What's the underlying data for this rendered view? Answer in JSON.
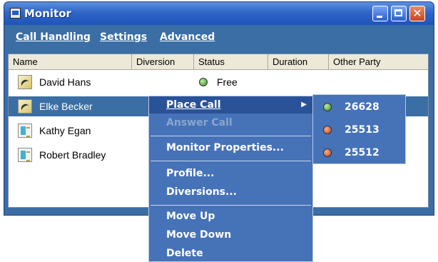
{
  "window": {
    "title": "Monitor",
    "icons": {
      "app": "monitor-app-icon",
      "minimize": "minimize-icon",
      "maximize": "maximize-icon",
      "close": "close-icon"
    }
  },
  "menubar": {
    "items": [
      {
        "label": "Call Handling"
      },
      {
        "label": "Settings"
      },
      {
        "label": "Advanced"
      }
    ]
  },
  "table": {
    "columns": [
      "Name",
      "Diversion",
      "Status",
      "Duration",
      "Other Party"
    ],
    "rows": [
      {
        "name": "David Hans",
        "icon": "phone-icon",
        "status": "Free",
        "status_color": "green",
        "selected": false
      },
      {
        "name": "Elke Becker",
        "icon": "phone-icon",
        "status": "",
        "selected": true
      },
      {
        "name": "Kathy Egan",
        "icon": "contact-card-icon",
        "status": "",
        "selected": false
      },
      {
        "name": "Robert Bradley",
        "icon": "contact-card-icon",
        "status": "",
        "selected": false
      }
    ]
  },
  "context_menu": {
    "items": [
      {
        "label": "Place Call",
        "state": "highlighted",
        "has_submenu": true
      },
      {
        "label": "Answer Call",
        "state": "disabled"
      },
      {
        "label": "Monitor Properties...",
        "state": "normal"
      },
      {
        "label": "Profile...",
        "state": "normal"
      },
      {
        "label": "Diversions...",
        "state": "normal"
      },
      {
        "label": "Move Up",
        "state": "normal"
      },
      {
        "label": "Move Down",
        "state": "normal"
      },
      {
        "label": "Delete",
        "state": "normal"
      }
    ],
    "submenu": [
      {
        "number": "26628",
        "status_color": "green"
      },
      {
        "number": "25513",
        "status_color": "red"
      },
      {
        "number": "25512",
        "status_color": "red"
      }
    ]
  },
  "colors": {
    "selection": "#3a6ea5",
    "menu_background": "#4672b8",
    "menu_highlight": "#2a5298",
    "titlebar": "#2f66c7"
  }
}
